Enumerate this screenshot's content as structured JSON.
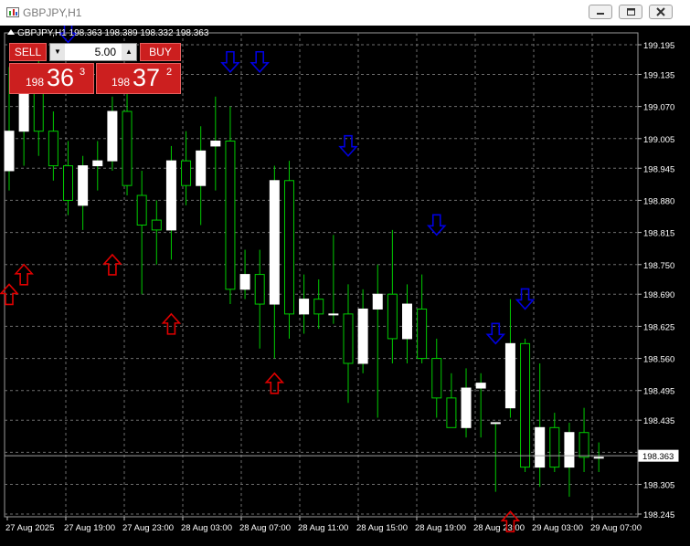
{
  "window": {
    "title": "GBPJPY,H1"
  },
  "chart_info": {
    "ohlc_text": "GBPJPY,H1  198.363 198.389 198.332 198.363"
  },
  "trade_panel": {
    "sell_label": "SELL",
    "buy_label": "BUY",
    "lot": "5.00",
    "sell_price": {
      "prefix": "198",
      "big": "36",
      "sup": "3"
    },
    "buy_price": {
      "prefix": "198",
      "big": "37",
      "sup": "2"
    }
  },
  "colors": {
    "bull": "#ffffff",
    "bear": "#000000",
    "wick": "#00cc00",
    "grid": "#6e6e6e",
    "up_arrow": "#e00000",
    "down_arrow": "#0000e0"
  },
  "chart_data": {
    "type": "candlestick",
    "symbol": "GBPJPY",
    "timeframe": "H1",
    "y_ticks": [
      "199.195",
      "199.135",
      "199.070",
      "199.005",
      "198.945",
      "198.880",
      "198.815",
      "198.750",
      "198.690",
      "198.625",
      "198.560",
      "198.495",
      "198.435",
      "198.370",
      "198.305",
      "198.245"
    ],
    "y_range": [
      198.245,
      199.195
    ],
    "current_price": "198.363",
    "x_ticks": [
      "27 Aug 2025",
      "27 Aug 19:00",
      "27 Aug 23:00",
      "28 Aug 03:00",
      "28 Aug 07:00",
      "28 Aug 11:00",
      "28 Aug 15:00",
      "28 Aug 19:00",
      "28 Aug 23:00",
      "29 Aug 03:00",
      "29 Aug 07:00"
    ],
    "candles": [
      {
        "o": 198.94,
        "h": 199.15,
        "l": 198.9,
        "c": 199.02
      },
      {
        "o": 199.02,
        "h": 199.13,
        "l": 198.95,
        "c": 199.1
      },
      {
        "o": 199.1,
        "h": 199.18,
        "l": 198.97,
        "c": 199.02
      },
      {
        "o": 199.02,
        "h": 199.06,
        "l": 198.92,
        "c": 198.95
      },
      {
        "o": 198.95,
        "h": 199.0,
        "l": 198.85,
        "c": 198.88
      },
      {
        "o": 198.87,
        "h": 198.97,
        "l": 198.82,
        "c": 198.95
      },
      {
        "o": 198.95,
        "h": 199.0,
        "l": 198.9,
        "c": 198.96
      },
      {
        "o": 198.96,
        "h": 199.09,
        "l": 198.94,
        "c": 199.06
      },
      {
        "o": 199.06,
        "h": 199.1,
        "l": 198.89,
        "c": 198.91
      },
      {
        "o": 198.89,
        "h": 198.94,
        "l": 198.69,
        "c": 198.83
      },
      {
        "o": 198.84,
        "h": 198.88,
        "l": 198.75,
        "c": 198.82
      },
      {
        "o": 198.82,
        "h": 198.99,
        "l": 198.76,
        "c": 198.96
      },
      {
        "o": 198.96,
        "h": 199.02,
        "l": 198.87,
        "c": 198.91
      },
      {
        "o": 198.91,
        "h": 199.03,
        "l": 198.83,
        "c": 198.98
      },
      {
        "o": 198.99,
        "h": 199.09,
        "l": 198.9,
        "c": 199.0
      },
      {
        "o": 199.0,
        "h": 199.07,
        "l": 198.67,
        "c": 198.7
      },
      {
        "o": 198.7,
        "h": 198.78,
        "l": 198.68,
        "c": 198.73
      },
      {
        "o": 198.73,
        "h": 198.78,
        "l": 198.58,
        "c": 198.67
      },
      {
        "o": 198.67,
        "h": 198.95,
        "l": 198.56,
        "c": 198.92
      },
      {
        "o": 198.92,
        "h": 198.96,
        "l": 198.6,
        "c": 198.65
      },
      {
        "o": 198.65,
        "h": 198.73,
        "l": 198.61,
        "c": 198.68
      },
      {
        "o": 198.68,
        "h": 198.72,
        "l": 198.62,
        "c": 198.65
      },
      {
        "o": 198.65,
        "h": 198.81,
        "l": 198.63,
        "c": 198.65
      },
      {
        "o": 198.65,
        "h": 198.71,
        "l": 198.47,
        "c": 198.55
      },
      {
        "o": 198.55,
        "h": 198.7,
        "l": 198.53,
        "c": 198.66
      },
      {
        "o": 198.66,
        "h": 198.75,
        "l": 198.44,
        "c": 198.69
      },
      {
        "o": 198.69,
        "h": 198.82,
        "l": 198.55,
        "c": 198.6
      },
      {
        "o": 198.6,
        "h": 198.71,
        "l": 198.55,
        "c": 198.67
      },
      {
        "o": 198.66,
        "h": 198.73,
        "l": 198.55,
        "c": 198.56
      },
      {
        "o": 198.56,
        "h": 198.6,
        "l": 198.44,
        "c": 198.48
      },
      {
        "o": 198.48,
        "h": 198.53,
        "l": 198.42,
        "c": 198.42
      },
      {
        "o": 198.42,
        "h": 198.54,
        "l": 198.4,
        "c": 198.5
      },
      {
        "o": 198.5,
        "h": 198.53,
        "l": 198.4,
        "c": 198.51
      },
      {
        "o": 198.43,
        "h": 198.43,
        "l": 198.29,
        "c": 198.43
      },
      {
        "o": 198.46,
        "h": 198.68,
        "l": 198.44,
        "c": 198.59
      },
      {
        "o": 198.59,
        "h": 198.6,
        "l": 198.33,
        "c": 198.34
      },
      {
        "o": 198.34,
        "h": 198.55,
        "l": 198.3,
        "c": 198.42
      },
      {
        "o": 198.42,
        "h": 198.45,
        "l": 198.33,
        "c": 198.34
      },
      {
        "o": 198.34,
        "h": 198.43,
        "l": 198.28,
        "c": 198.41
      },
      {
        "o": 198.41,
        "h": 198.46,
        "l": 198.33,
        "c": 198.36
      },
      {
        "o": 198.36,
        "h": 198.39,
        "l": 198.33,
        "c": 198.36
      }
    ],
    "signals": [
      {
        "type": "up",
        "index": 0,
        "price": 198.71
      },
      {
        "type": "up",
        "index": 1,
        "price": 198.75
      },
      {
        "type": "up",
        "index": 7,
        "price": 198.77
      },
      {
        "type": "up",
        "index": 11,
        "price": 198.65
      },
      {
        "type": "up",
        "index": 18,
        "price": 198.53
      },
      {
        "type": "up",
        "index": 34,
        "price": 198.25
      },
      {
        "type": "down",
        "index": 4,
        "price": 199.2
      },
      {
        "type": "down",
        "index": 15,
        "price": 199.14
      },
      {
        "type": "down",
        "index": 17,
        "price": 199.14
      },
      {
        "type": "down",
        "index": 23,
        "price": 198.97
      },
      {
        "type": "down",
        "index": 29,
        "price": 198.81
      },
      {
        "type": "down",
        "index": 33,
        "price": 198.59
      },
      {
        "type": "down",
        "index": 35,
        "price": 198.66
      }
    ]
  }
}
